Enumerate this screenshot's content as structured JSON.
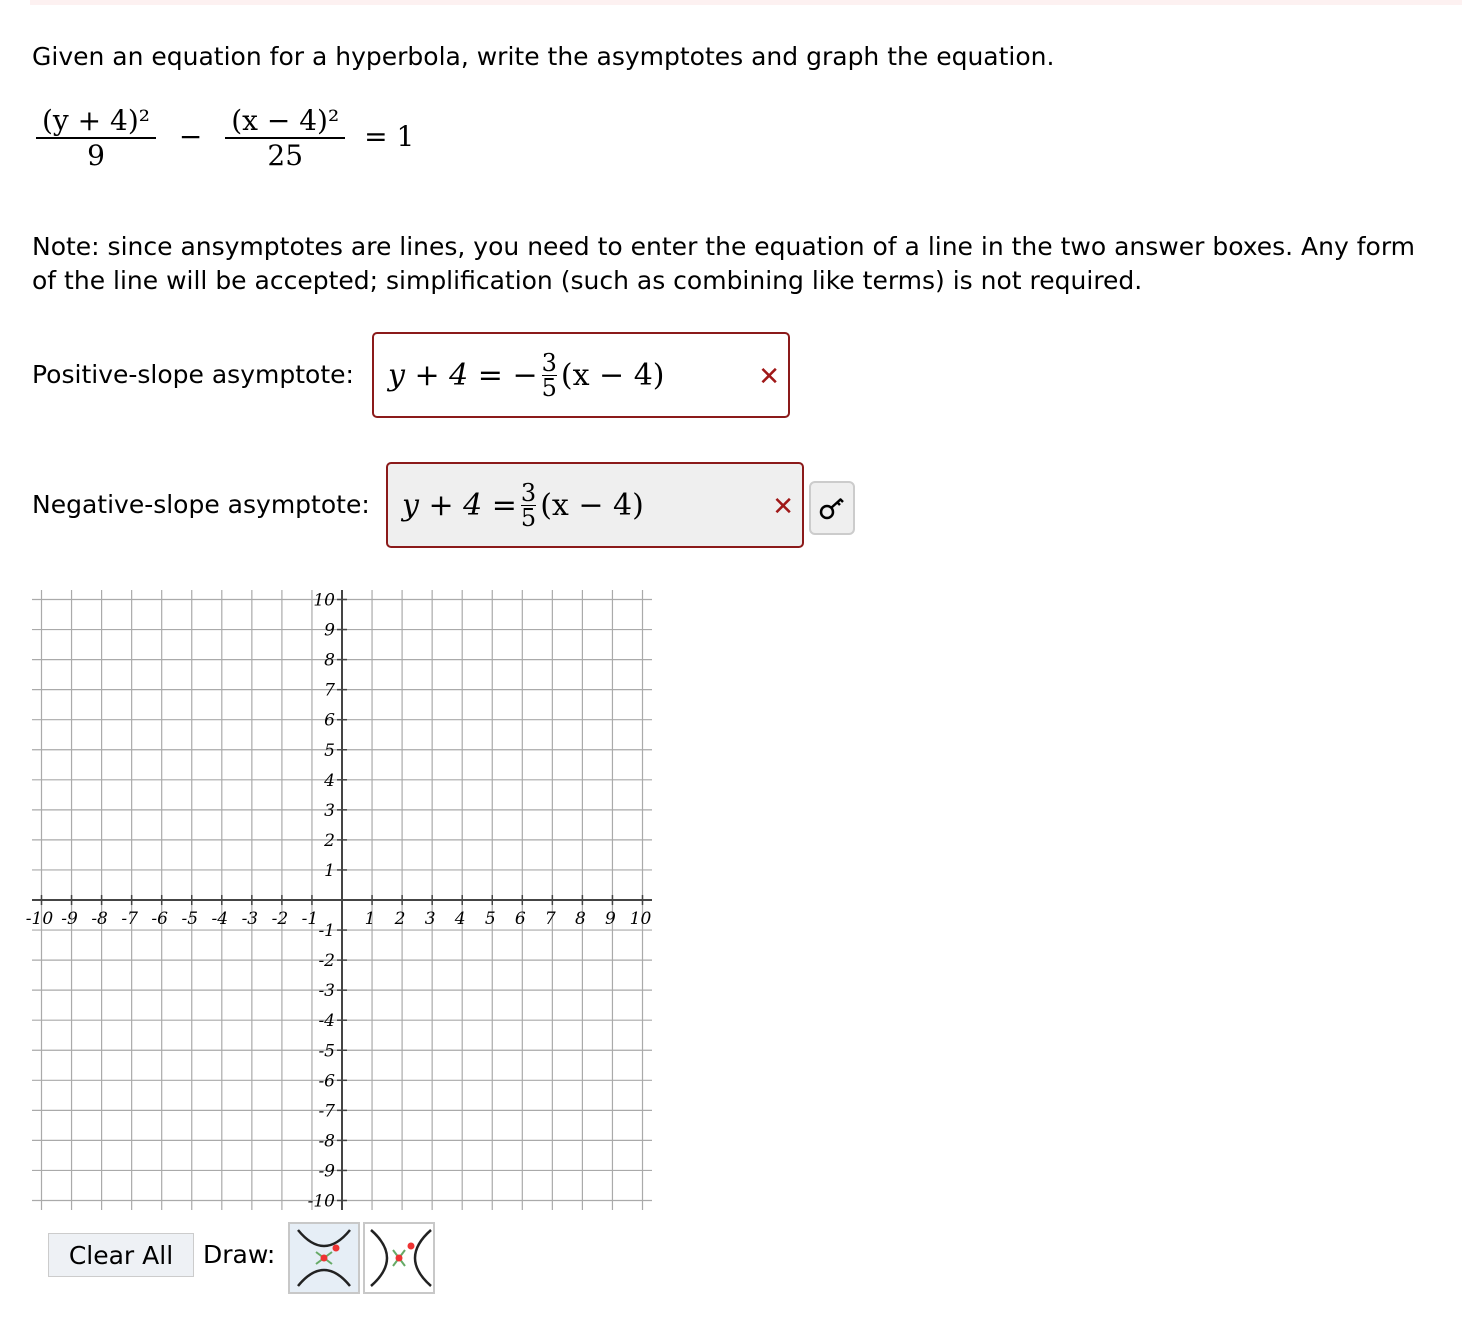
{
  "prompt": "Given an equation for a hyperbola, write the asymptotes and graph the equation.",
  "equation": {
    "term1_num": "(y + 4)²",
    "term1_den": "9",
    "minus": "−",
    "term2_num": "(x − 4)²",
    "term2_den": "25",
    "rhs": "= 1"
  },
  "note": "Note: since ansymptotes are lines, you need to enter the equation of a line in the two answer boxes. Any form of the line will be accepted; simplification (such as combining like terms) is not required.",
  "positive": {
    "label": "Positive-slope asymptote:",
    "lhs": "y + 4 = −",
    "frac_num": "3",
    "frac_den": "5",
    "rhs": "(x − 4)",
    "status": "incorrect",
    "mark": "✕"
  },
  "negative": {
    "label": "Negative-slope asymptote:",
    "lhs": "y + 4 =",
    "frac_num": "3",
    "frac_den": "5",
    "rhs": "(x − 4)",
    "status": "incorrect",
    "mark": "✕"
  },
  "key_icon": "key-icon",
  "chart_data": {
    "type": "scatter",
    "xlim": [
      -10,
      10
    ],
    "ylim": [
      -10,
      10
    ],
    "grid": true,
    "x_ticks": [
      "-10",
      "-9",
      "-8",
      "-7",
      "-6",
      "-5",
      "-4",
      "-3",
      "-2",
      "-1",
      "1",
      "2",
      "3",
      "4",
      "5",
      "6",
      "7",
      "8",
      "9",
      "10"
    ],
    "y_ticks": [
      "10",
      "9",
      "8",
      "7",
      "6",
      "5",
      "4",
      "3",
      "2",
      "1",
      "-1",
      "-2",
      "-3",
      "-4",
      "-5",
      "-6",
      "-7",
      "-8",
      "-9",
      "-10"
    ],
    "series": []
  },
  "controls": {
    "clear_all": "Clear All",
    "draw": "Draw:",
    "tools": [
      {
        "name": "vertical-hyperbola",
        "selected": true
      },
      {
        "name": "horizontal-hyperbola",
        "selected": false
      }
    ]
  },
  "colors": {
    "error": "#a01818",
    "border": "#8b1a1a"
  }
}
